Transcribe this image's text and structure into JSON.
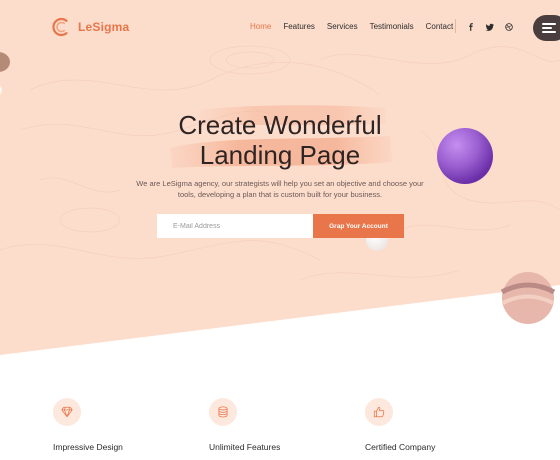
{
  "brand": {
    "name": "LeSigma",
    "accent": "#e8764a"
  },
  "nav": {
    "items": [
      {
        "label": "Home",
        "active": true
      },
      {
        "label": "Features",
        "active": false
      },
      {
        "label": "Services",
        "active": false
      },
      {
        "label": "Testimonials",
        "active": false
      },
      {
        "label": "Contact",
        "active": false
      }
    ],
    "social": [
      "facebook-icon",
      "twitter-icon",
      "dribbble-icon"
    ]
  },
  "hero": {
    "title_line1": "Create Wonderful",
    "title_line2": "Landing Page",
    "subtitle": "We are LeSigma agency, our strategists will help you set an objective and choose your tools, developing a plan that is custom built for your business.",
    "email_placeholder": "E-Mail Address",
    "cta_label": "Grap Your Account",
    "background": "#fcdccb",
    "sphere_color": "#9b5fd0"
  },
  "features": [
    {
      "icon": "diamond-icon",
      "title": "Impressive Design"
    },
    {
      "icon": "database-icon",
      "title": "Unlimited Features"
    },
    {
      "icon": "thumbs-up-icon",
      "title": "Certified Company"
    }
  ]
}
